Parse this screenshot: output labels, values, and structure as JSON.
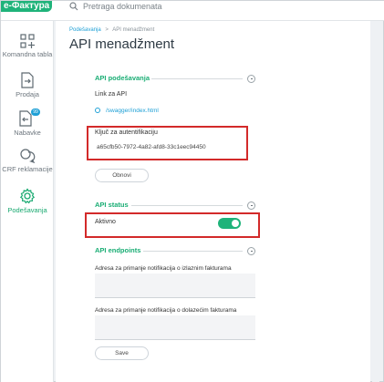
{
  "app": {
    "logo_text": "e-Фактура",
    "search_placeholder": "Pretraga dokumenata"
  },
  "sidebar": {
    "items": [
      {
        "label": "Komandna tabla",
        "icon": "dashboard-grid-icon",
        "active": false
      },
      {
        "label": "Prodaja",
        "icon": "outgoing-document-icon",
        "active": false
      },
      {
        "label": "Nabavke",
        "icon": "incoming-document-icon",
        "active": false,
        "badge": "99"
      },
      {
        "label": "CRF reklamacije",
        "icon": "chat-bubbles-icon",
        "active": false
      },
      {
        "label": "Podešavanja",
        "icon": "gear-icon",
        "active": true
      }
    ]
  },
  "breadcrumb": {
    "root": "Podešavanja",
    "separator": ">",
    "current": "API menadžment"
  },
  "page": {
    "title": "API menadžment"
  },
  "api_settings": {
    "heading": "API podešavanja",
    "link_label": "Link za API",
    "link_value": "/swagger/index.html",
    "key_label": "Ključ za autentifikaciju",
    "key_value": "a65cfb50-7972-4a82-afd8-33c1eec94450",
    "refresh_button": "Obnovi"
  },
  "api_status": {
    "heading": "API status",
    "active_label": "Aktivno",
    "active": true
  },
  "api_endpoints": {
    "heading": "API endpoints",
    "outgoing_label": "Adresa za primanje notifikacija o izlaznim fakturama",
    "outgoing_value": "",
    "incoming_label": "Adresa za primanje notifikacija o dolazećim fakturama",
    "incoming_value": "",
    "save_button": "Save"
  },
  "colors": {
    "accent": "#1fb37a",
    "link": "#1fa0d6",
    "highlight": "#d32a2a"
  }
}
